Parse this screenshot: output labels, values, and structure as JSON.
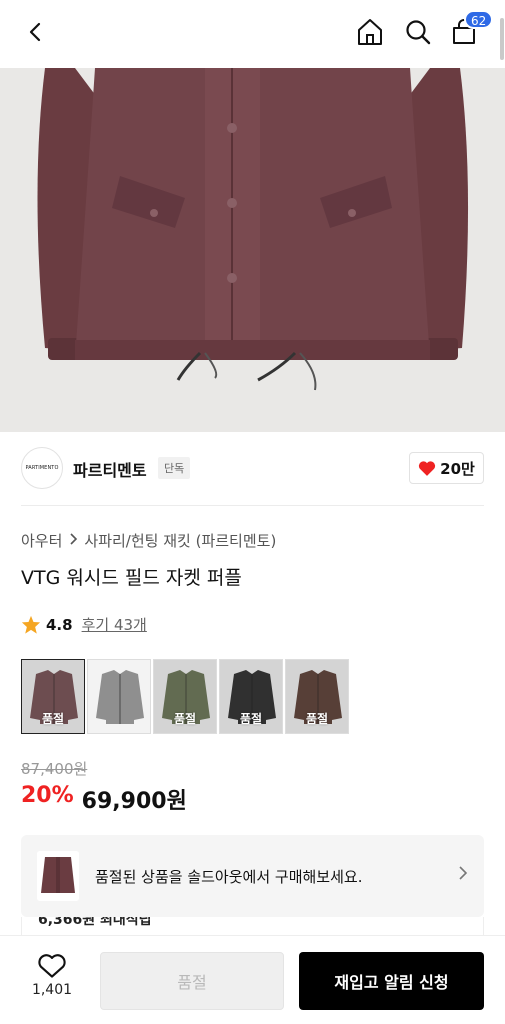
{
  "header": {
    "cart_count": "62",
    "icons": [
      "back-icon",
      "home-icon",
      "search-icon",
      "shopping-bag-icon"
    ]
  },
  "brand": {
    "logo_text": "PARTIMENTO",
    "name": "파르티멘토",
    "tag": "단독",
    "likes": "20만"
  },
  "product": {
    "breadcrumb": [
      "아우터",
      "사파리/헌팅 재킷 (파르티멘토)"
    ],
    "title": "VTG 워시드 필드 자켓 퍼플",
    "rating": "4.8",
    "reviews": "후기 43개",
    "swatches": [
      {
        "color": "#6a3f43",
        "label": "품절",
        "selected": true
      },
      {
        "color": "#8f8f8f",
        "label": "",
        "selected": false
      },
      {
        "color": "#5b6745",
        "label": "품절",
        "selected": false
      },
      {
        "color": "#181818",
        "label": "품절",
        "selected": false
      },
      {
        "color": "#4d2d22",
        "label": "품절",
        "selected": false
      }
    ],
    "original_price": "87,400원",
    "discount": "20%",
    "price": "69,900원"
  },
  "notice": {
    "text": "품절된 상품을 솔드아웃에서 구매해보세요."
  },
  "peek": {
    "text": "6,366원 최대적립"
  },
  "bottom": {
    "wish_count": "1,401",
    "soldout_label": "품절",
    "restock_label": "재입고 알림 신청"
  },
  "colors": {
    "accent_red": "#ef2222",
    "badge_blue": "#2f6ae6",
    "jacket": "#6b3e43"
  }
}
